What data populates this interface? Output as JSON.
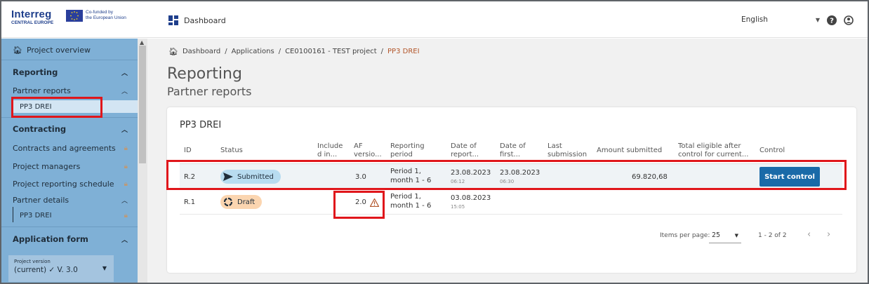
{
  "brand": {
    "logo_word": "Interreg",
    "logo_sub": "CENTRAL EUROPE",
    "eu_line1": "Co-funded by",
    "eu_line2": "the European Union",
    "accent_color": "#1f3f8c"
  },
  "topbar": {
    "dashboard_label": "Dashboard",
    "language": "English",
    "icons": [
      "help-icon",
      "account-icon"
    ]
  },
  "sidebar": {
    "project_overview": "Project overview",
    "reporting": "Reporting",
    "partner_reports": "Partner reports",
    "selected_report": "PP3 DREI",
    "contracting": "Contracting",
    "contracts": "Contracts and agreements",
    "project_managers": "Project managers",
    "reporting_schedule": "Project reporting schedule",
    "partner_details": "Partner details",
    "partner_details_item": "PP3 DREI",
    "application_form": "Application form",
    "version_label": "Project version",
    "version_value": "(current) ✓ V. 3.0",
    "bg_color": "#7fb0d6"
  },
  "breadcrumb": {
    "items": [
      "Dashboard",
      "Applications",
      "CE0100161 - TEST project"
    ],
    "active": "PP3 DREI"
  },
  "page": {
    "title": "Reporting",
    "subtitle": "Partner reports"
  },
  "table": {
    "card_title": "PP3 DREI",
    "headers": {
      "id": "ID",
      "status": "Status",
      "include1": "Include",
      "include2": "d in...",
      "af1": "AF",
      "af2": "versio...",
      "rp1": "Reporting",
      "rp2": "period",
      "dor1": "Date of",
      "dor2": "report...",
      "dof1": "Date of",
      "dof2": "first...",
      "ls1": "Last",
      "ls2": "submission",
      "amount": "Amount submitted",
      "te1": "Total eligible after",
      "te2": "control for current...",
      "control": "Control"
    },
    "rows": [
      {
        "id": "R.2",
        "status": "Submitted",
        "af_version": "3.0",
        "period_line1": "Period 1,",
        "period_line2": "month 1 - 6",
        "report_date": "23.08.2023",
        "report_time": "06:12",
        "first_date": "23.08.2023",
        "first_time": "06:30",
        "amount": "69.820,68",
        "control_button": "Start control"
      },
      {
        "id": "R.1",
        "status": "Draft",
        "af_version": "2.0",
        "period_line1": "Period 1,",
        "period_line2": "month 1 - 6",
        "report_date": "03.08.2023",
        "report_time": "15:05"
      }
    ]
  },
  "pagination": {
    "items_per_page_label": "Items per page:",
    "items_per_page": "25",
    "range": "1 - 2 of 2"
  },
  "colors": {
    "highlight": "#e0161b",
    "submitted_badge": "#b8dcf0",
    "draft_badge": "#fbd5b0",
    "primary_button": "#1a6aa8",
    "breadcrumb_active": "#b3562a"
  }
}
